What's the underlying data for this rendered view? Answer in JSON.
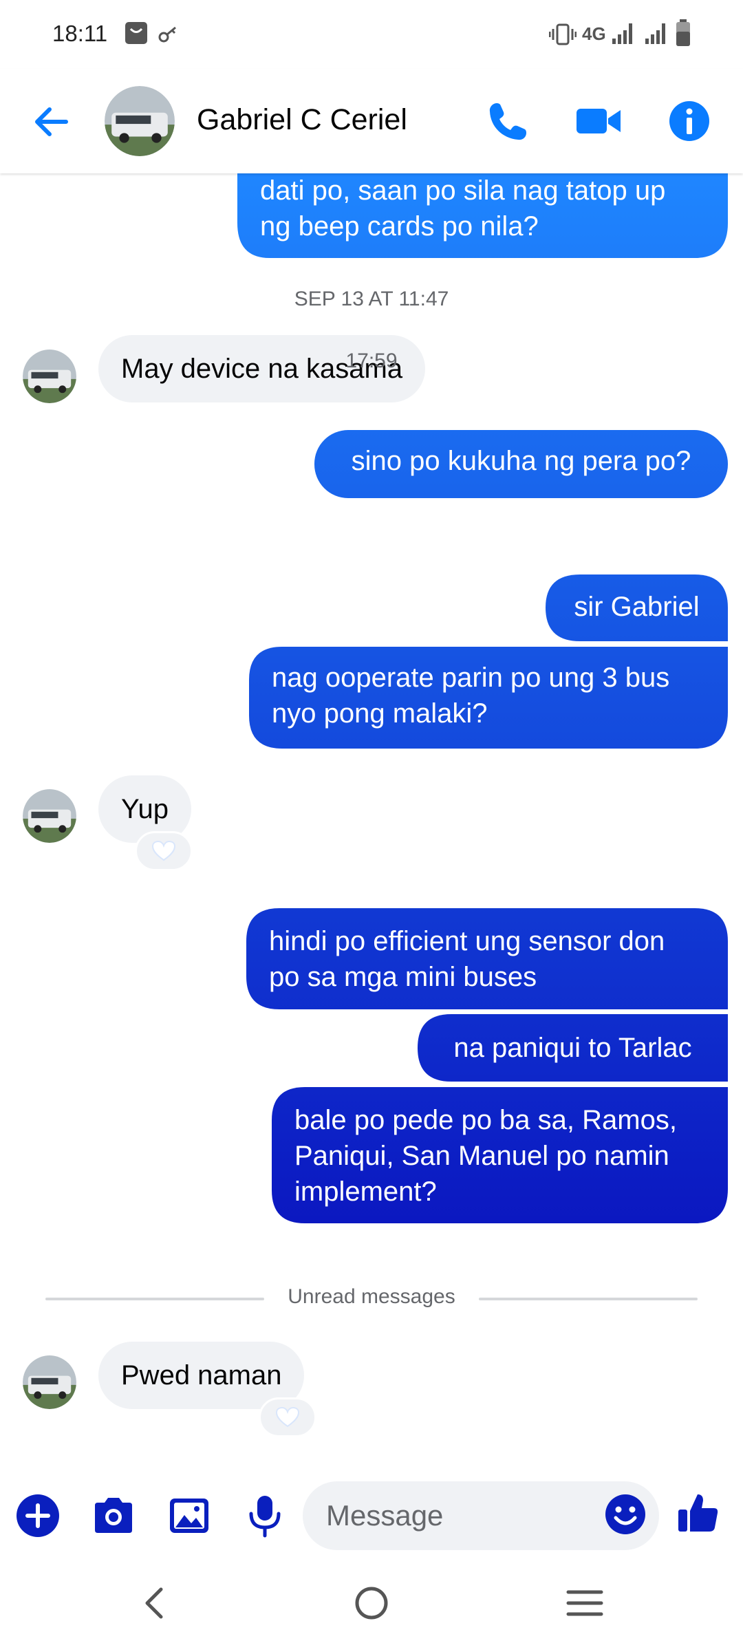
{
  "status_bar": {
    "time": "18:11",
    "network": "4G",
    "icons": [
      "notification-bag-icon",
      "vpn-key-icon",
      "vibrate-icon",
      "signal-icon",
      "battery-icon"
    ]
  },
  "header": {
    "contact_name": "Gabriel C Ceriel",
    "icons": [
      "back-arrow-icon",
      "phone-icon",
      "video-camera-icon",
      "info-icon"
    ]
  },
  "messages": {
    "m1": "dati po, saan po sila nag tatop up",
    "m1b": "ng beep cards po nila?",
    "ts1": "SEP 13 AT 11:47",
    "m2": "May device na kasama",
    "m3": "sino po kukuha ng pera po?",
    "ts2": "17:59",
    "m4": "sir Gabriel",
    "m5": "nag ooperate parin po ung 3 bus",
    "m5b": "nyo pong malaki?",
    "m6": "Yup",
    "m7": "hindi po efficient ung sensor don",
    "m7b": "po sa mga mini buses",
    "m8": "na paniqui to Tarlac",
    "m9": "bale po pede po ba sa, Ramos,",
    "m9b": "Paniqui, San Manuel po namin",
    "m9c": "implement?",
    "unread": "Unread messages",
    "m10": "Pwed naman"
  },
  "composer": {
    "placeholder": "Message",
    "icons": [
      "add-icon",
      "camera-icon",
      "gallery-icon",
      "microphone-icon",
      "emoji-icon",
      "thumbs-up-icon"
    ]
  },
  "navbar": {
    "icons": [
      "nav-back-icon",
      "nav-home-icon",
      "nav-recents-icon"
    ]
  },
  "colors": {
    "accent": "#0a7cff",
    "bubble_top": "#1877f2",
    "bubble_bottom": "#0a1fbe",
    "incoming_bubble": "#f0f2f5",
    "secondary_text": "#65676b"
  }
}
